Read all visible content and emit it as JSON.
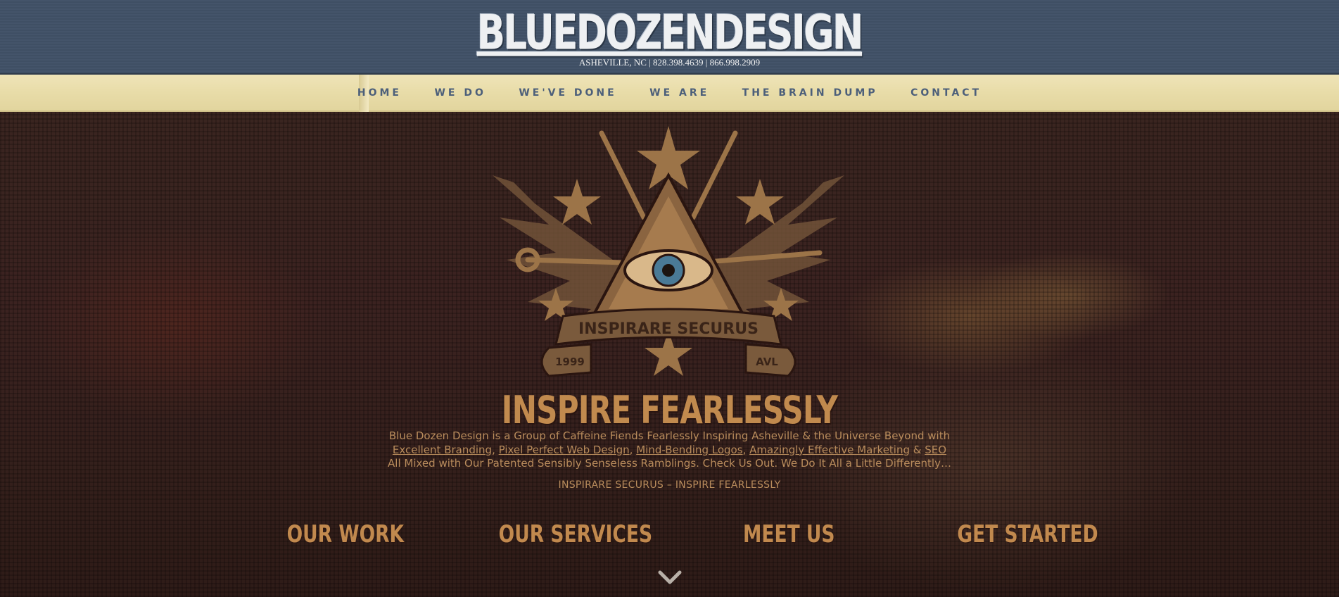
{
  "header": {
    "logo_text": "BLUEDOZENDESIGN",
    "contact_line": "ASHEVILLE, NC | 828.398.4639 | 866.998.2909"
  },
  "nav": {
    "items": [
      {
        "label": "HOME"
      },
      {
        "label": "WE DO"
      },
      {
        "label": "WE'VE DONE"
      },
      {
        "label": "WE ARE"
      },
      {
        "label": "THE BRAIN DUMP"
      },
      {
        "label": "CONTACT"
      }
    ]
  },
  "emblem": {
    "banner_text": "INSPIRARE SECURUS",
    "year_left": "1999",
    "year_right": "AVL"
  },
  "hero": {
    "headline": "INSPIRE FEARLESSLY",
    "intro_line1": "Blue Dozen Design is a Group of Caffeine Fiends Fearlessly Inspiring Asheville & the Universe Beyond with",
    "links": {
      "branding": "Excellent Branding",
      "web_design": "Pixel Perfect Web Design",
      "logos": "Mind-Bending Logos",
      "marketing": "Amazingly Effective Marketing",
      "and": "&",
      "seo": "SEO"
    },
    "intro_line3": "All Mixed with Our Patented Sensibly Senseless Ramblings. Check Us Out. We Do It All a Little Differently…",
    "tagline": "INSPIRARE SECURUS – INSPIRE FEARLESSLY"
  },
  "ctas": {
    "work": "OUR WORK",
    "services": "OUR SERVICES",
    "meet": "MEET US",
    "start": "GET STARTED"
  },
  "colors": {
    "header_bg": "#44546a",
    "nav_bg": "#e8dca8",
    "nav_text": "#4c5f7a",
    "accent_copper": "#c1894e"
  },
  "icons": {
    "scroll": "chevron-down-icon"
  }
}
